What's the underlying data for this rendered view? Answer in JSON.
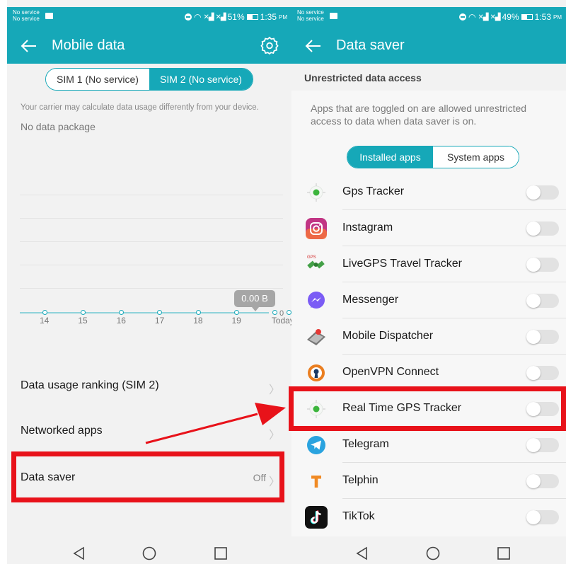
{
  "left_screen": {
    "status": {
      "service_line1": "No service",
      "service_line2": "No service",
      "battery": "51%",
      "time": "1:35",
      "ampm": "PM",
      "battery_fill": 0.51
    },
    "title": "Mobile data",
    "sim_tabs": [
      "SIM 1 (No service)",
      "SIM 2 (No service)"
    ],
    "active_sim_tab": 1,
    "carrier_note": "Your carrier may calculate data usage differently from your device.",
    "no_package": "No data package",
    "chart_data": {
      "type": "line",
      "categories": [
        "14",
        "15",
        "16",
        "17",
        "18",
        "19",
        "Today"
      ],
      "values": [
        0,
        0,
        0,
        0,
        0,
        0,
        0
      ],
      "current_label": "0.00 B",
      "y_label": "0"
    },
    "rows": [
      {
        "label": "Data usage ranking (SIM 2)",
        "value": ""
      },
      {
        "label": "Networked apps",
        "value": ""
      },
      {
        "label": "Data saver",
        "value": "Off"
      }
    ]
  },
  "right_screen": {
    "status": {
      "service_line1": "No service",
      "service_line2": "No service",
      "battery": "49%",
      "time": "1:53",
      "ampm": "PM",
      "battery_fill": 0.49
    },
    "title": "Data saver",
    "section_header": "Unrestricted data access",
    "description": "Apps that are toggled on are allowed unrestricted access to data when data saver is on.",
    "tabs": [
      "Installed apps",
      "System apps"
    ],
    "active_tab": 0,
    "apps": [
      {
        "name": "Gps Tracker",
        "icon": "gps-tracker-icon",
        "enabled": false
      },
      {
        "name": "Instagram",
        "icon": "instagram-icon",
        "enabled": false
      },
      {
        "name": "LiveGPS Travel Tracker",
        "icon": "satellite-icon",
        "enabled": false
      },
      {
        "name": "Messenger",
        "icon": "messenger-icon",
        "enabled": false
      },
      {
        "name": "Mobile Dispatcher",
        "icon": "dispatcher-icon",
        "enabled": false
      },
      {
        "name": "OpenVPN Connect",
        "icon": "openvpn-icon",
        "enabled": false
      },
      {
        "name": "Real Time GPS Tracker",
        "icon": "gps-tracker-icon",
        "enabled": false
      },
      {
        "name": "Telegram",
        "icon": "telegram-icon",
        "enabled": false
      },
      {
        "name": "Telphin",
        "icon": "telphin-icon",
        "enabled": false
      },
      {
        "name": "TikTok",
        "icon": "tiktok-icon",
        "enabled": false
      }
    ]
  },
  "colors": {
    "accent": "#16a8b8",
    "highlight": "#e8121a"
  }
}
